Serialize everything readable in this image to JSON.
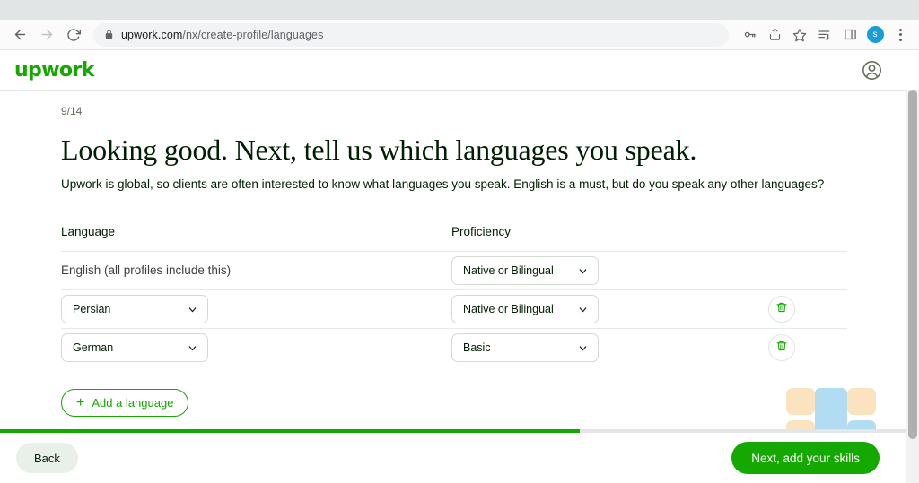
{
  "browser": {
    "back_icon": "arrow-left-icon",
    "forward_icon": "arrow-right-icon",
    "reload_icon": "reload-icon",
    "lock_icon": "lock-icon",
    "url_host": "upwork.com",
    "url_path": "/nx/create-profile/languages",
    "url_full": "upwork.com/nx/create-profile/languages",
    "icons": [
      "key-icon",
      "share-icon",
      "star-icon",
      "reading-list-icon",
      "side-panel-icon"
    ],
    "profile_initial": "s",
    "menu_icon": "kebab-menu-icon"
  },
  "site_header": {
    "logo_text": "upwork",
    "logo_color": "#14a800",
    "account_icon": "user-circle-icon"
  },
  "content": {
    "step_counter": "9/14",
    "title": "Looking good. Next, tell us which languages you speak.",
    "subtitle": "Upwork is global, so clients are often interested to know what languages you speak. English is a must, but do you speak any other languages?"
  },
  "table": {
    "headers": {
      "language": "Language",
      "proficiency": "Proficiency"
    },
    "rows": [
      {
        "language_label": "English (all profiles include this)",
        "language_is_select": false,
        "proficiency": "Native or Bilingual",
        "deletable": false
      },
      {
        "language_label": "Persian",
        "language_is_select": true,
        "proficiency": "Native or Bilingual",
        "deletable": true,
        "delete_icon": "trash-icon"
      },
      {
        "language_label": "German",
        "language_is_select": true,
        "proficiency": "Basic",
        "deletable": true,
        "delete_icon": "trash-icon"
      }
    ]
  },
  "add_language": {
    "label": "Add a language",
    "icon": "plus-icon"
  },
  "progress": {
    "percent": 64,
    "fill_color": "#14a800",
    "track_color": "#e4e5e7"
  },
  "footer": {
    "back_label": "Back",
    "next_label": "Next, add your skills",
    "next_color": "#14a800"
  },
  "watermark": {
    "name": "decorative-blocks-graphic",
    "blue": "#a5d6ef",
    "peach": "#fbdfb4"
  }
}
